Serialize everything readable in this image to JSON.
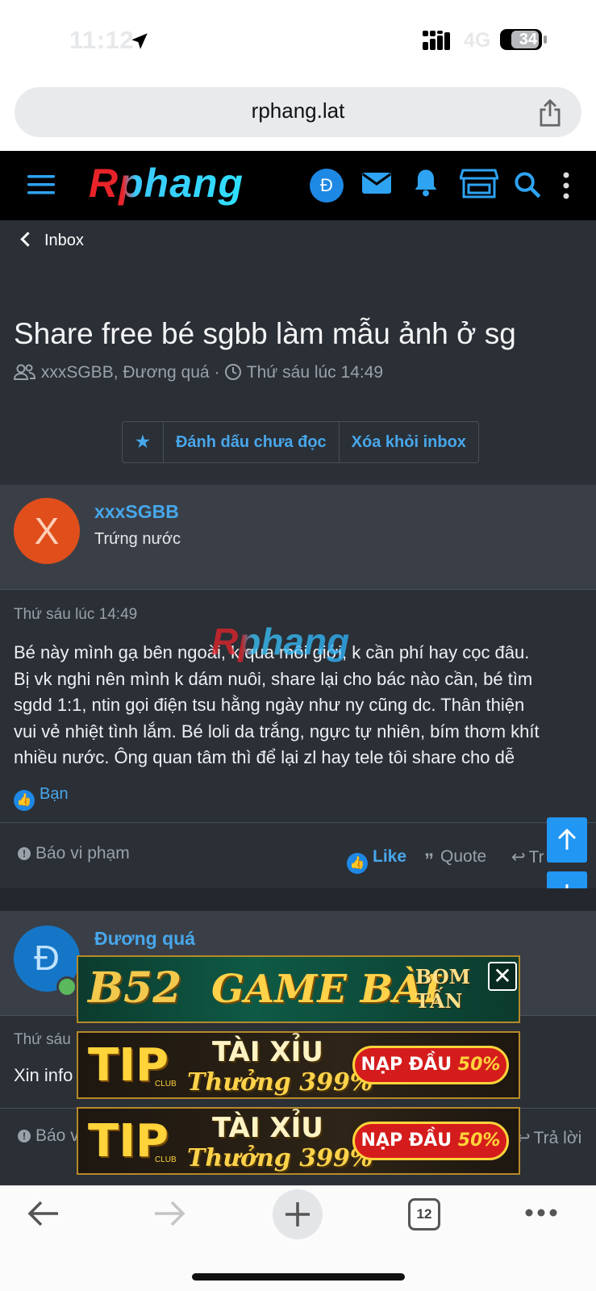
{
  "status_bar": {
    "time": "11:12",
    "network": "4G",
    "battery": "34"
  },
  "browser": {
    "url": "rphang.lat",
    "tab_count": "12"
  },
  "site": {
    "logo": "Rphang",
    "user_avatar_letter": "Đ"
  },
  "breadcrumb": {
    "back_label": "Inbox"
  },
  "conversation": {
    "title": "Share free bé sgbb làm mẫu ảnh ở sg",
    "participants": "xxxSGBB, Đương quá",
    "separator": "·",
    "date": "Thứ sáu lúc 14:49"
  },
  "actions": {
    "star": "★",
    "mark_unread": "Đánh dấu chưa đọc",
    "remove_inbox": "Xóa khỏi inbox"
  },
  "messages": [
    {
      "avatar_letter": "X",
      "username": "xxxSGBB",
      "user_title": "Trứng nước",
      "date": "Thứ sáu lúc 14:49",
      "lines": [
        "Bé này mình gạ bên ngoài, k qua môi giới, k cần phí hay cọc đâu.",
        "Bị vk nghi nên mình k dám nuôi, share lại cho bác nào cần, bé tìm",
        "sgdd 1:1, ntin gọi điện tsu hằng ngày như ny cũng dc. Thân thiện",
        "vui vẻ nhiệt tình lắm. Bé loli da trắng, ngực tự nhiên, bím thơm khít",
        "nhiều nước. Ông quan tâm thì để lại zl hay tele tôi share cho dễ"
      ],
      "likes": "Bạn",
      "report": "Báo vi phạm",
      "like": "Like",
      "quote": "Quote",
      "reply": "Tr"
    },
    {
      "avatar_letter": "Đ",
      "username": "Đương quá",
      "date": "Thứ sáu",
      "text": "Xin info",
      "report": "Báo v",
      "reply": "Trả lời"
    }
  ],
  "watermark": "Rphang",
  "ads": [
    {
      "brand": "B52",
      "headline": "GAME BÀI",
      "side": [
        "BOM",
        "TẤN"
      ],
      "close": "✕"
    },
    {
      "brand": "TIP",
      "club": "CLUB",
      "headline": "TÀI XỈU",
      "sub": "Thưởng 399%",
      "pill": "NẠP ĐẦU",
      "pill_pct": "50%"
    },
    {
      "brand": "TIP",
      "club": "CLUB",
      "headline": "TÀI XỈU",
      "sub": "Thưởng 399%",
      "pill": "NẠP ĐẦU",
      "pill_pct": "50%"
    }
  ],
  "colors": {
    "link": "#47a7eb",
    "header": "#000000",
    "page_bg": "#2b2f36",
    "accent": "#2196f3"
  },
  "icons": [
    "location-arrow-icon",
    "signal-icon",
    "share-icon",
    "menu-icon",
    "mail-icon",
    "bell-icon",
    "store-icon",
    "search-icon",
    "more-vertical-icon",
    "users-icon",
    "clock-icon",
    "like-icon",
    "quote-icon",
    "reply-icon",
    "arrow-up-icon",
    "arrow-down-icon",
    "back-arrow-icon",
    "forward-arrow-icon",
    "plus-icon",
    "more-horizontal-icon"
  ]
}
